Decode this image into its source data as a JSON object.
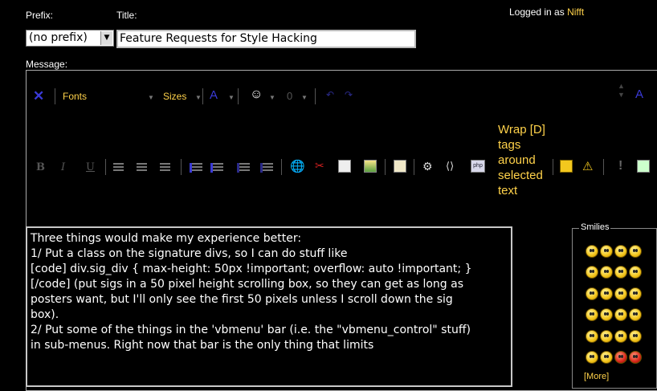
{
  "labels": {
    "prefix": "Prefix:",
    "title": "Title:",
    "message": "Message:"
  },
  "login": {
    "prefix_text": "Logged in as",
    "username": "Nifft"
  },
  "prefix_select": {
    "value": "(no prefix)"
  },
  "title_input": {
    "value": "Feature Requests for Style Hacking"
  },
  "toolbar": {
    "fonts_label": "Fonts",
    "sizes_label": "Sizes",
    "wrap_label": "Wrap [D] tags around selected text"
  },
  "message": {
    "lines": [
      "Three things would make my experience better:",
      "",
      "1/ Put a class on the signature divs, so I can do stuff like",
      "[code] div.sig_div { max-height: 50px !important; overflow: auto !important; }",
      "[/code] (put sigs in a 50 pixel height scrolling box, so they can get as long as",
      "posters want, but I'll only see the first 50 pixels unless I scroll down the sig",
      "box).",
      "",
      "2/ Put some of the things in the 'vbmenu' bar (i.e. the \"vbmenu_control\" stuff)",
      "in sub-menus. Right now that bar is the only thing that limits"
    ]
  },
  "smilies": {
    "legend": "Smilies",
    "more_label": "[More]"
  },
  "colors": {
    "accent": "#ffd24a",
    "background": "#000000",
    "text": "#ffffff"
  }
}
